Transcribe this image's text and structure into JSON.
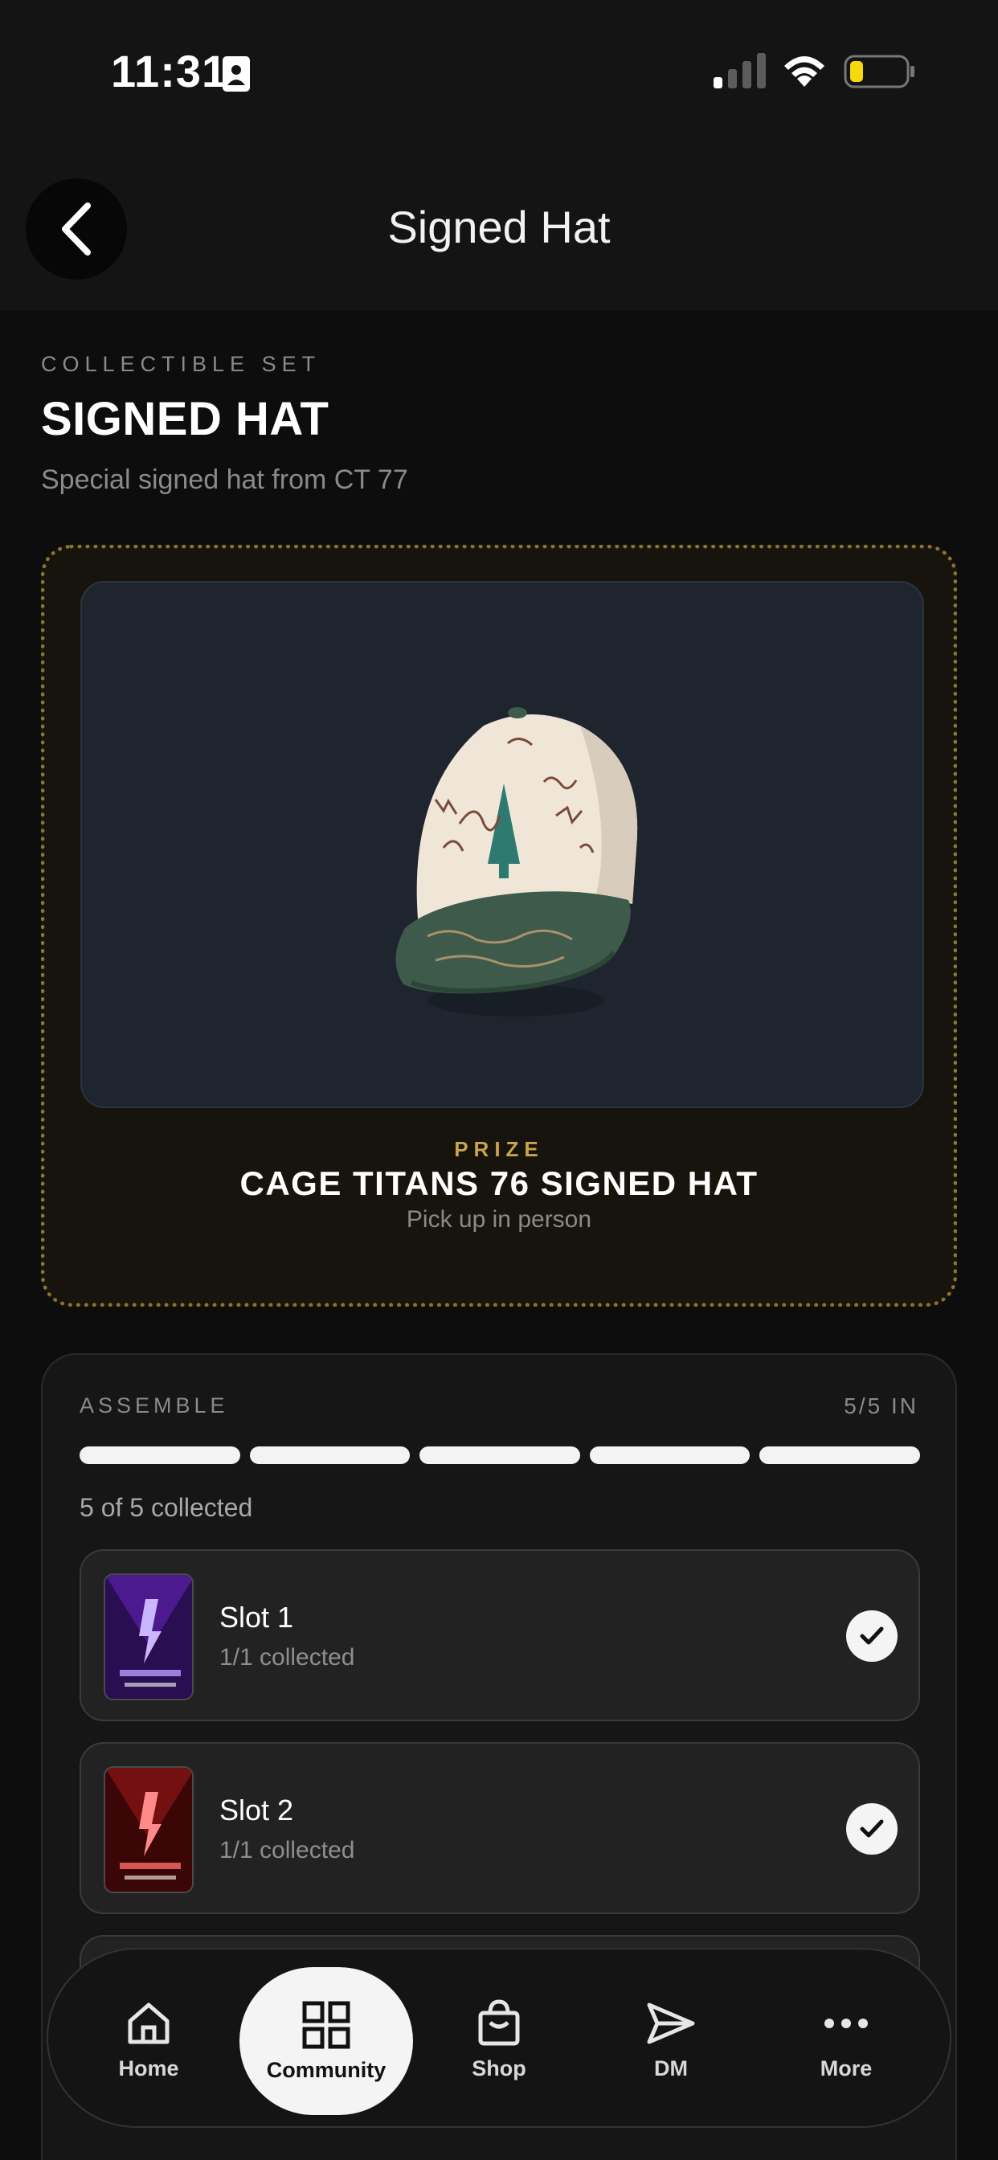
{
  "status_bar": {
    "time": "11:31"
  },
  "header": {
    "title": "Signed Hat"
  },
  "set": {
    "eyebrow": "COLLECTIBLE SET",
    "title": "SIGNED HAT",
    "subtitle": "Special signed hat from CT 77"
  },
  "prize": {
    "eyebrow": "PRIZE",
    "title": "CAGE TITANS 76 SIGNED HAT",
    "subtitle": "Pick up in person"
  },
  "assemble": {
    "label": "ASSEMBLE",
    "count": "5/5 IN",
    "progress": {
      "filled": 5,
      "total": 5
    },
    "collected_text": "5 of 5 collected",
    "slots": [
      {
        "name": "Slot 1",
        "status": "1/1 collected",
        "thumb_color": "#5a1fa8"
      },
      {
        "name": "Slot 2",
        "status": "1/1 collected",
        "thumb_color": "#8a1414"
      }
    ]
  },
  "tabbar": {
    "items": [
      {
        "label": "Home",
        "icon": "home-icon"
      },
      {
        "label": "Community",
        "icon": "grid-icon",
        "active": true
      },
      {
        "label": "Shop",
        "icon": "shopping-bag-icon"
      },
      {
        "label": "DM",
        "icon": "send-icon"
      },
      {
        "label": "More",
        "icon": "more-dots-icon"
      }
    ]
  },
  "colors": {
    "background": "#0d0d0d",
    "accent_gold": "#c9a44a",
    "card": "#161616"
  }
}
